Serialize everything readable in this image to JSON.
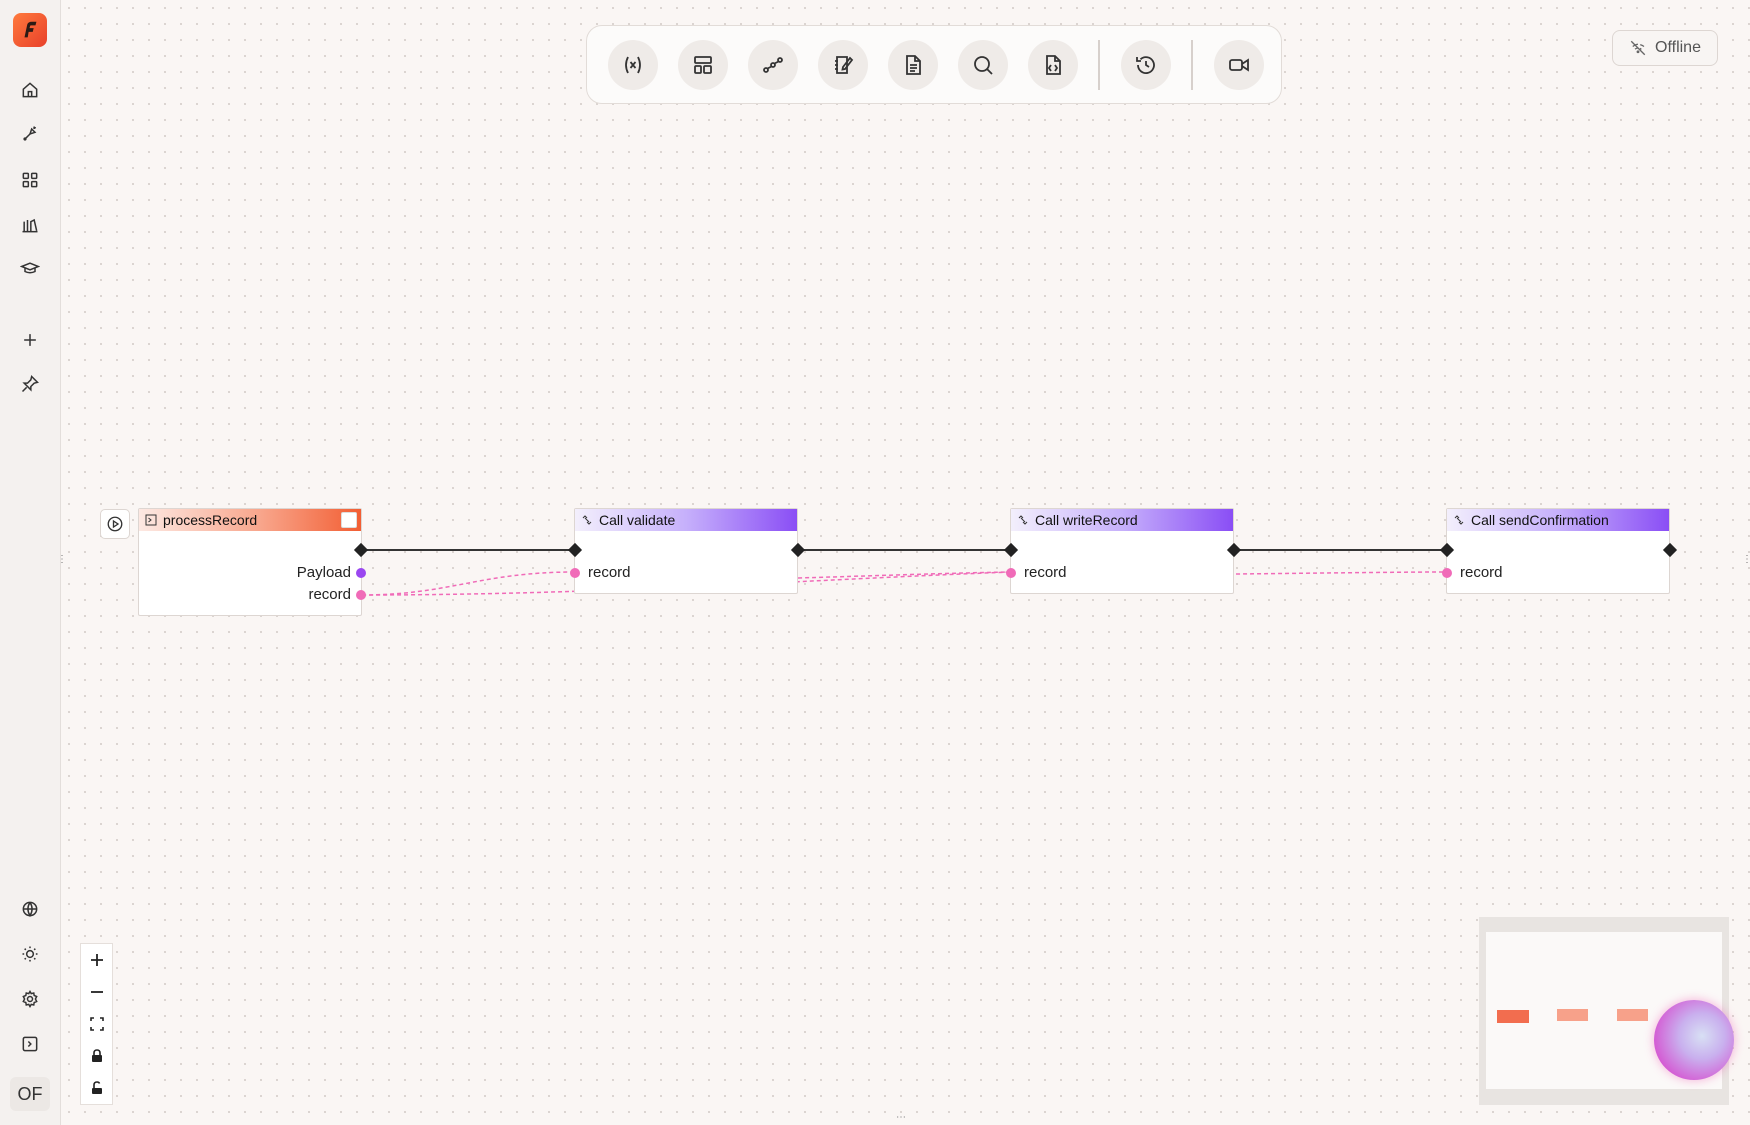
{
  "app": {
    "user_initials": "OF"
  },
  "sidebar": {
    "items": [
      {
        "name": "home-icon"
      },
      {
        "name": "flows-icon"
      },
      {
        "name": "apps-grid-icon"
      },
      {
        "name": "library-icon"
      },
      {
        "name": "learn-icon"
      },
      {
        "name": "add-icon"
      },
      {
        "name": "pin-icon"
      }
    ],
    "bottom_items": [
      {
        "name": "globe-icon"
      },
      {
        "name": "theme-sun-icon"
      },
      {
        "name": "settings-gear-icon"
      },
      {
        "name": "console-icon"
      }
    ]
  },
  "toolbar": {
    "tools": [
      {
        "name": "variables-icon"
      },
      {
        "name": "layout-icon"
      },
      {
        "name": "workflow-icon"
      },
      {
        "name": "notebook-icon"
      },
      {
        "name": "document-icon"
      },
      {
        "name": "search-icon"
      },
      {
        "name": "code-file-icon"
      },
      {
        "name": "history-icon"
      },
      {
        "name": "record-video-icon"
      }
    ]
  },
  "status": {
    "connection": "Offline"
  },
  "flow": {
    "nodes": [
      {
        "id": "start",
        "title": "processRecord",
        "kind": "function",
        "ports": [
          "Payload",
          "record"
        ]
      },
      {
        "id": "n1",
        "title": "Call validate",
        "kind": "call",
        "ports": [
          "record"
        ]
      },
      {
        "id": "n2",
        "title": "Call writeRecord",
        "kind": "call",
        "ports": [
          "record"
        ]
      },
      {
        "id": "n3",
        "title": "Call sendConfirmation",
        "kind": "call",
        "ports": [
          "record"
        ]
      }
    ],
    "colors": {
      "exec_wire": "#333333",
      "data_wire": "#f06bb8",
      "function_accent": "#f25e33",
      "call_accent": "#8a4ef5"
    }
  },
  "zoom_controls": [
    {
      "name": "zoom-in-icon"
    },
    {
      "name": "zoom-out-icon"
    },
    {
      "name": "fit-view-icon"
    },
    {
      "name": "lock-icon"
    },
    {
      "name": "unlock-icon"
    }
  ]
}
